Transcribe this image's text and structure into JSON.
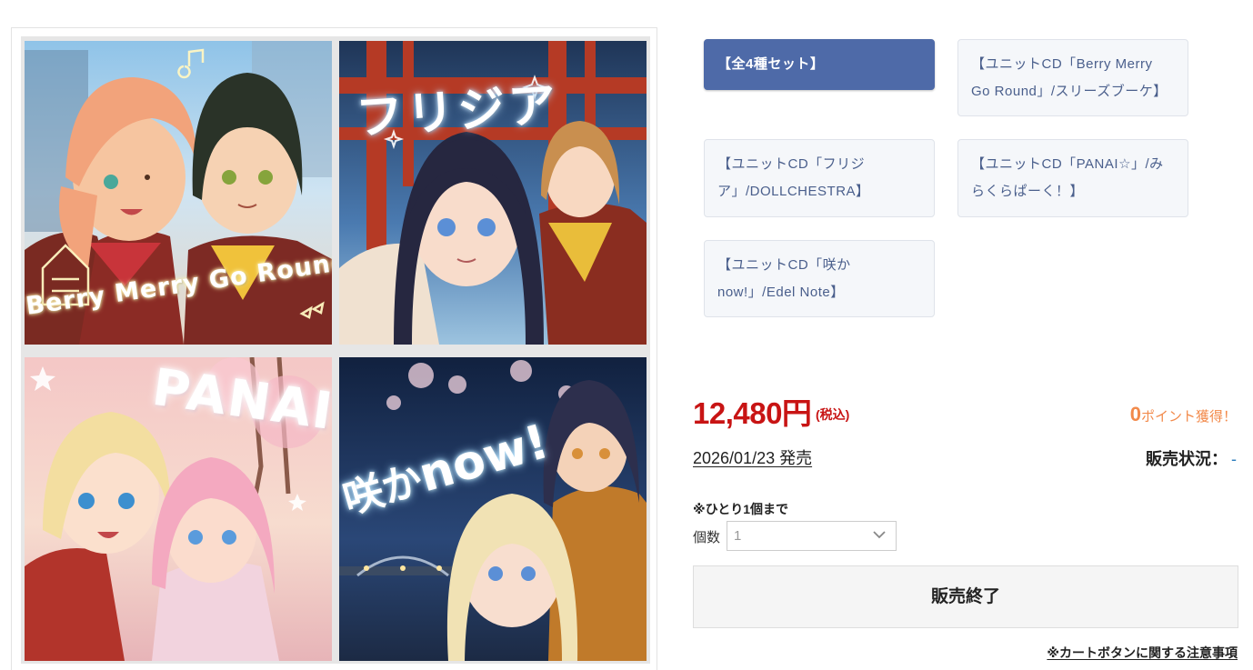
{
  "jackets": {
    "berry": {
      "title": "Berry Merry Go Round"
    },
    "freesia": {
      "title": "フリジア"
    },
    "panai": {
      "title": "PANAI☆"
    },
    "sakika": {
      "title_jp": "咲か",
      "title_en": "now!"
    }
  },
  "variants": [
    {
      "label": "【全4種セット】",
      "active": true
    },
    {
      "label": "【ユニットCD「Berry Merry Go Round」/スリーズブーケ】",
      "active": false
    },
    {
      "label": "【ユニットCD「フリジア」/DOLLCHESTRA】",
      "active": false
    },
    {
      "label": "【ユニットCD「PANAI☆」/みらくらぱーく！】",
      "active": false
    },
    {
      "label": "【ユニットCD「咲かnow!」/Edel Note】",
      "active": false
    }
  ],
  "product": {
    "price": "12,480円",
    "price_tax": "(税込)",
    "points_value": "0",
    "points_suffix": "ポイント獲得！",
    "release": "2026/01/23 発売",
    "status_label": "販売状況：",
    "status_value": "-",
    "purchase_limit": "※ひとり1個まで",
    "quantity_label": "個数",
    "quantity_value": "1",
    "cart_button": "販売終了",
    "notice_link": "※カートボタンに関する注意事項"
  },
  "colors": {
    "accent": "#4e6aa8",
    "price": "#c81414",
    "points": "#f28a4b",
    "status_value": "#2d7fbe"
  },
  "icons": [
    "chevron-down-icon"
  ]
}
